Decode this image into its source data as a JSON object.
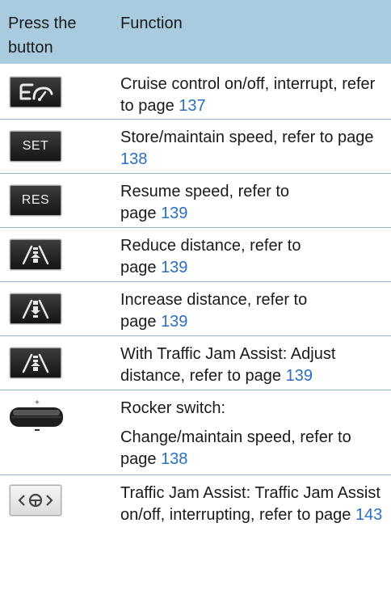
{
  "header": {
    "col1": "Press the button",
    "col2": "Function"
  },
  "rows": [
    {
      "icon": "cruise-control-icon",
      "text": "Cruise control on/off, interrupt, refer to page ",
      "page": "137"
    },
    {
      "icon": "set-button",
      "label": "SET",
      "text": "Store/maintain speed, refer to page ",
      "page": "138"
    },
    {
      "icon": "res-button",
      "label": "RES",
      "text": "Resume speed, refer to page ",
      "page": "139"
    },
    {
      "icon": "reduce-distance-icon",
      "text": "Reduce distance, refer to page ",
      "page": "139"
    },
    {
      "icon": "increase-distance-icon",
      "text": "Increase distance, refer to page ",
      "page": "139"
    },
    {
      "icon": "adjust-distance-icon",
      "text": "With Traffic Jam Assist: Adjust distance, refer to page ",
      "page": "139"
    },
    {
      "icon": "rocker-switch-icon",
      "title": "Rocker switch:",
      "text": "Change/maintain speed, refer to page ",
      "page": "138"
    },
    {
      "icon": "traffic-jam-assist-icon",
      "text": "Traffic Jam Assist: Traffic Jam Assist on/off, interrupting, refer to page ",
      "page": "143"
    }
  ]
}
